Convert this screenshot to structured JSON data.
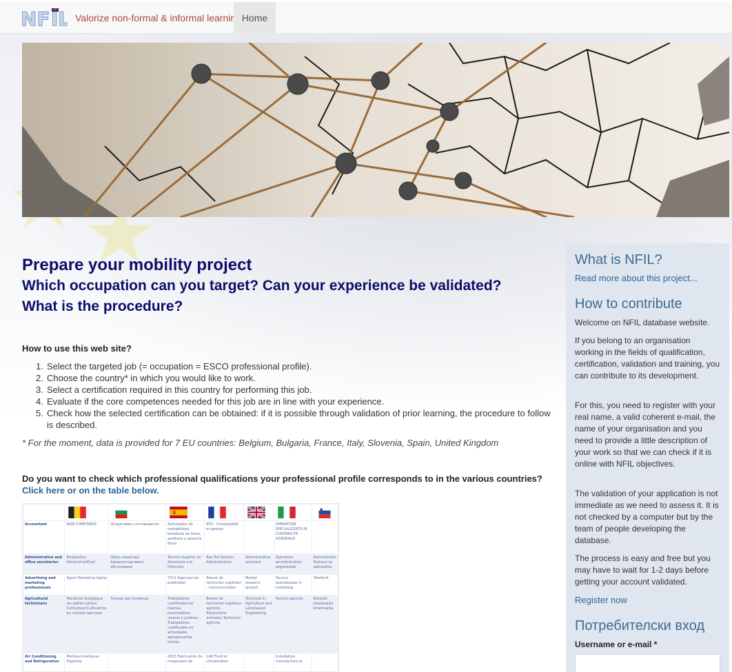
{
  "navbar": {
    "logo_text": "NFIL",
    "brand": "Valorize non-formal & informal learning",
    "home": "Home"
  },
  "main": {
    "title": "Prepare your mobility project",
    "subtitle1": "Which occupation can you target? Can your experience be validated?",
    "subtitle2": "What is the procedure?",
    "howto_title": "How to use this web site?",
    "steps": [
      "Select the targeted job (= occupation = ESCO professional profile).",
      "Choose the country* in which you would like to work.",
      "Select a certification required in this country for performing this job.",
      "Evaluate if the core competences needed for this job are in line with your experience.",
      "Check how the selected certification can be obtained: if it is possible through validation of prior learning, the procedure to follow is described."
    ],
    "note": "* For the moment, data is provided for 7 EU countries: Belgium, Bulgaria, France, Italy, Slovenia, Spain, United Kingdom",
    "question": "Do you want to check which professional qualifications your professional profile corresponds to in the various countries?",
    "click_link": "Click here or on the table below."
  },
  "qualification_table": {
    "flags": [
      "belgium-flag",
      "bulgaria-flag",
      "spain-flag",
      "france-flag",
      "uk-flag",
      "italy-flag",
      "slovenia-flag"
    ],
    "rows": [
      {
        "occupation": "Accountant",
        "cells": [
          "AIDE COMPTABLE",
          "Оперативен счетоводител",
          "Actividades de contabilidad, teneduría de libros, auditoría y asesoría fiscal",
          "BTS - Comptabilité et gestion",
          "",
          "OPERATORE SPECIALIZZATO IN CONTABILITÀ AZIENDALE",
          ""
        ]
      },
      {
        "occupation": "Administrative and office secretaries",
        "cells": [
          "Employé(e) Administratif(ve)",
          "Офис-секретар/Административно обслужване",
          "Técnico Superior en Asistencia a la Dirección",
          "Bac Pro Gestion-Administration",
          "Administrative assistant",
          "Operatore amministrativo segretariale",
          "Administrativ Poslovni as sekretarka"
        ]
      },
      {
        "occupation": "Advertising and marketing professionals",
        "cells": [
          "Agent Marketing digital",
          "",
          "7311 Agencias de publicidad",
          "Brevet de technicien supérieur - Communication",
          "Market research analyst",
          "Tecnico specializzato in marketing",
          "Telefonik"
        ]
      },
      {
        "occupation": "Agricultural technicians",
        "cells": [
          "Maraîcher biologique sur petite surface Cultivateur/Cultivatrice en cultures agricoles",
          "Техник растениевъд",
          "Trabajadores cualificados en huertas, invernaderos, viveros y jardines. Trabajadores cualificados en actividades agropecuarias mixtas.",
          "Brevet de technicien supérieur agricole - Productions animales Technicien agricole",
          "Technical in Agriculture and Land-based Engineering",
          "Tecnico agricolo",
          "Ekološki kmetovalec kmetovalka"
        ]
      },
      {
        "occupation": "Air Conditioning and Refrigeration",
        "cells": [
          "Monteur/monteuse frigoriste",
          "",
          "2825 Fabricación de maquinaria de",
          "CAP Froid et climatisation",
          "",
          "Installatore manutentore di",
          ""
        ]
      }
    ]
  },
  "sidebar": {
    "what_title": "What is NFIL?",
    "read_more": "Read more about this project...",
    "contribute_title": "How to contribute",
    "welcome": "Welcome on NFIL database website.",
    "p1": "If you belong to an organisation working in the fields of qualification, certification, validation and training, you can contribute to its development.",
    "p2": "For this, you need to register with your real name, a valid coherent e-mail, the name of your organisation and you need to provide a little description of your work so that we can check if it is online with NFIL objectives.",
    "p3": "The validation of your application is not immediate as we need to assess it. It is not checked by a computer but by the team of people developing the database.",
    "p4": "The process is easy and free but you may have to wait for 1-2 days before getting your account validated.",
    "register": "Register now",
    "login_title": "Потребителски вход",
    "username_label": "Username or e-mail *",
    "username_value": ""
  }
}
